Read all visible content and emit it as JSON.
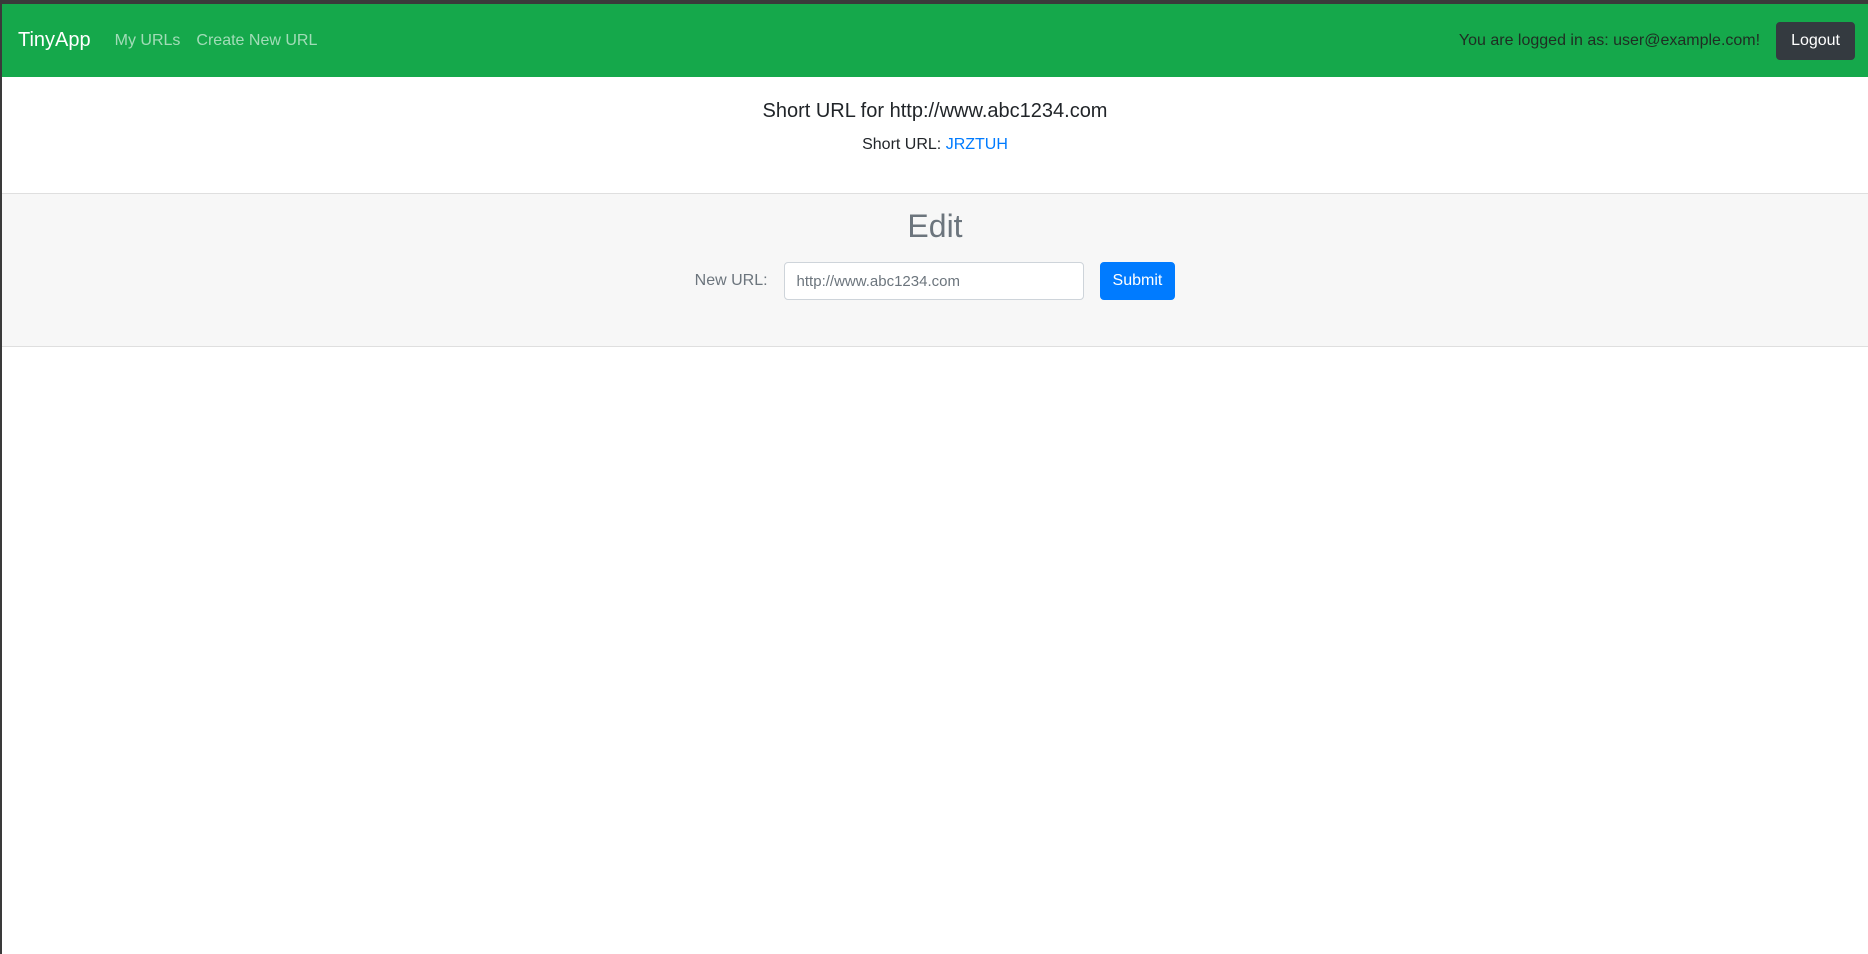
{
  "navbar": {
    "brand": "TinyApp",
    "links": [
      "My URLs",
      "Create New URL"
    ],
    "login_text": "You are logged in as: user@example.com!",
    "logout_label": "Logout",
    "bg_color": "#15a84b"
  },
  "url": {
    "title": "Short URL for http://www.abc1234.com",
    "short_prefix": "Short URL:",
    "short_code": "JRZTUH"
  },
  "edit": {
    "title": "Edit",
    "label": "New URL:",
    "input_placeholder": "http://www.abc1234.com",
    "submit_label": "Submit"
  }
}
